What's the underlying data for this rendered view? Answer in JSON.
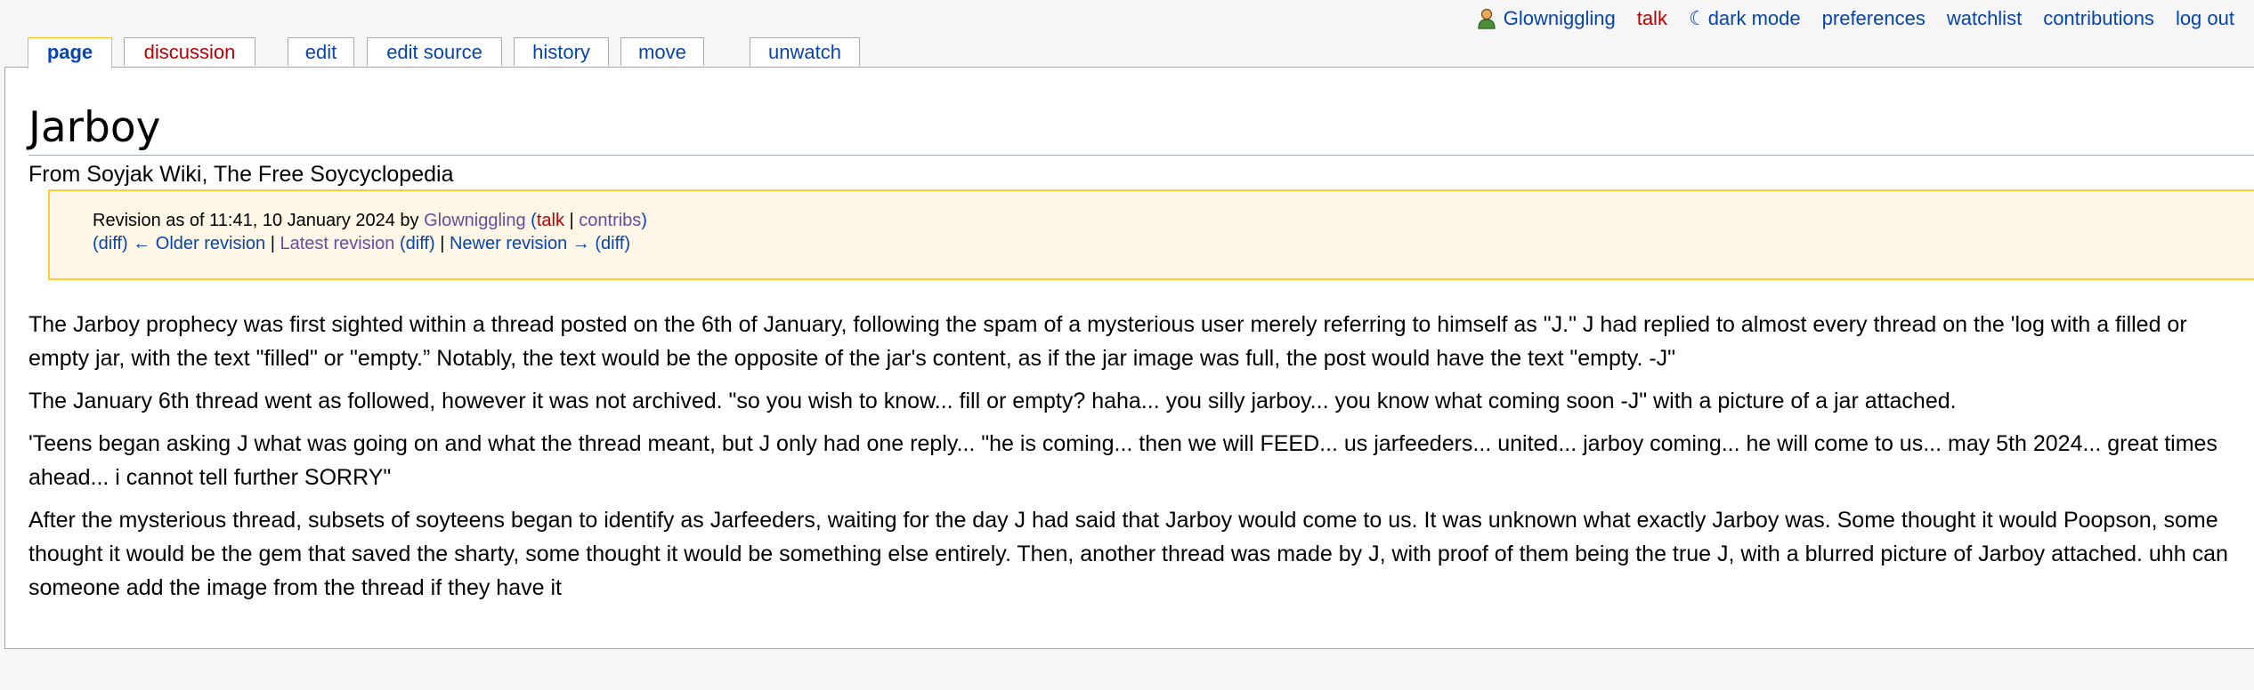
{
  "personal": {
    "username": "Glowniggling",
    "talk": "talk",
    "dark_icon": "☾",
    "dark_mode": "dark mode",
    "preferences": "preferences",
    "watchlist": "watchlist",
    "contributions": "contributions",
    "logout": "log out"
  },
  "tabs": {
    "page": "page",
    "discussion": "discussion",
    "edit": "edit",
    "edit_source": "edit source",
    "history": "history",
    "move": "move",
    "unwatch": "unwatch"
  },
  "article": {
    "title": "Jarboy",
    "tagline": "From Soyjak Wiki, The Free Soycyclopedia"
  },
  "revision": {
    "prefix": "Revision as of 11:41, 10 January 2024 by ",
    "user": "Glowniggling",
    "open_paren": " (",
    "talk": "talk",
    "sep": " | ",
    "contribs": "contribs",
    "close_paren": ")",
    "diff_open": "(",
    "diff1": "diff",
    "older": ") ← Older revision",
    "pipe": " | ",
    "latest": "Latest revision",
    "diff2_open": " (",
    "diff2": "diff",
    "diff2_close": ")",
    "pipe2": " | ",
    "newer": "Newer revision →",
    "diff3_open": " (",
    "diff3": "diff",
    "diff3_close": ")"
  },
  "paragraphs": [
    "The Jarboy prophecy was first sighted within a thread posted on the 6th of January, following the spam of a mysterious user merely referring to himself as \"J.\" J had replied to almost every thread on the 'log with a filled or empty jar, with the text \"filled\" or \"empty.” Notably, the text would be the opposite of the jar's content, as if the jar image was full, the post would have the text \"empty. -J\"",
    "The January 6th thread went as followed, however it was not archived. \"so you wish to know... fill or empty? haha... you silly jarboy... you know what coming soon -J\" with a picture of a jar attached.",
    "'Teens began asking J what was going on and what the thread meant, but J only had one reply... \"he is coming... then we will FEED... us jarfeeders... united... jarboy coming... he will come to us... may 5th 2024... great times ahead... i cannot tell further SORRY\"",
    "After the mysterious thread, subsets of soyteens began to identify as Jarfeeders, waiting for the day J had said that Jarboy would come to us. It was unknown what exactly Jarboy was. Some thought it would Poopson, some thought it would be the gem that saved the sharty, some thought it would be something else entirely. Then, another thread was made by J, with proof of them being the true J, with a blurred picture of Jarboy attached. uhh can someone add the image from the thread if they have it"
  ]
}
